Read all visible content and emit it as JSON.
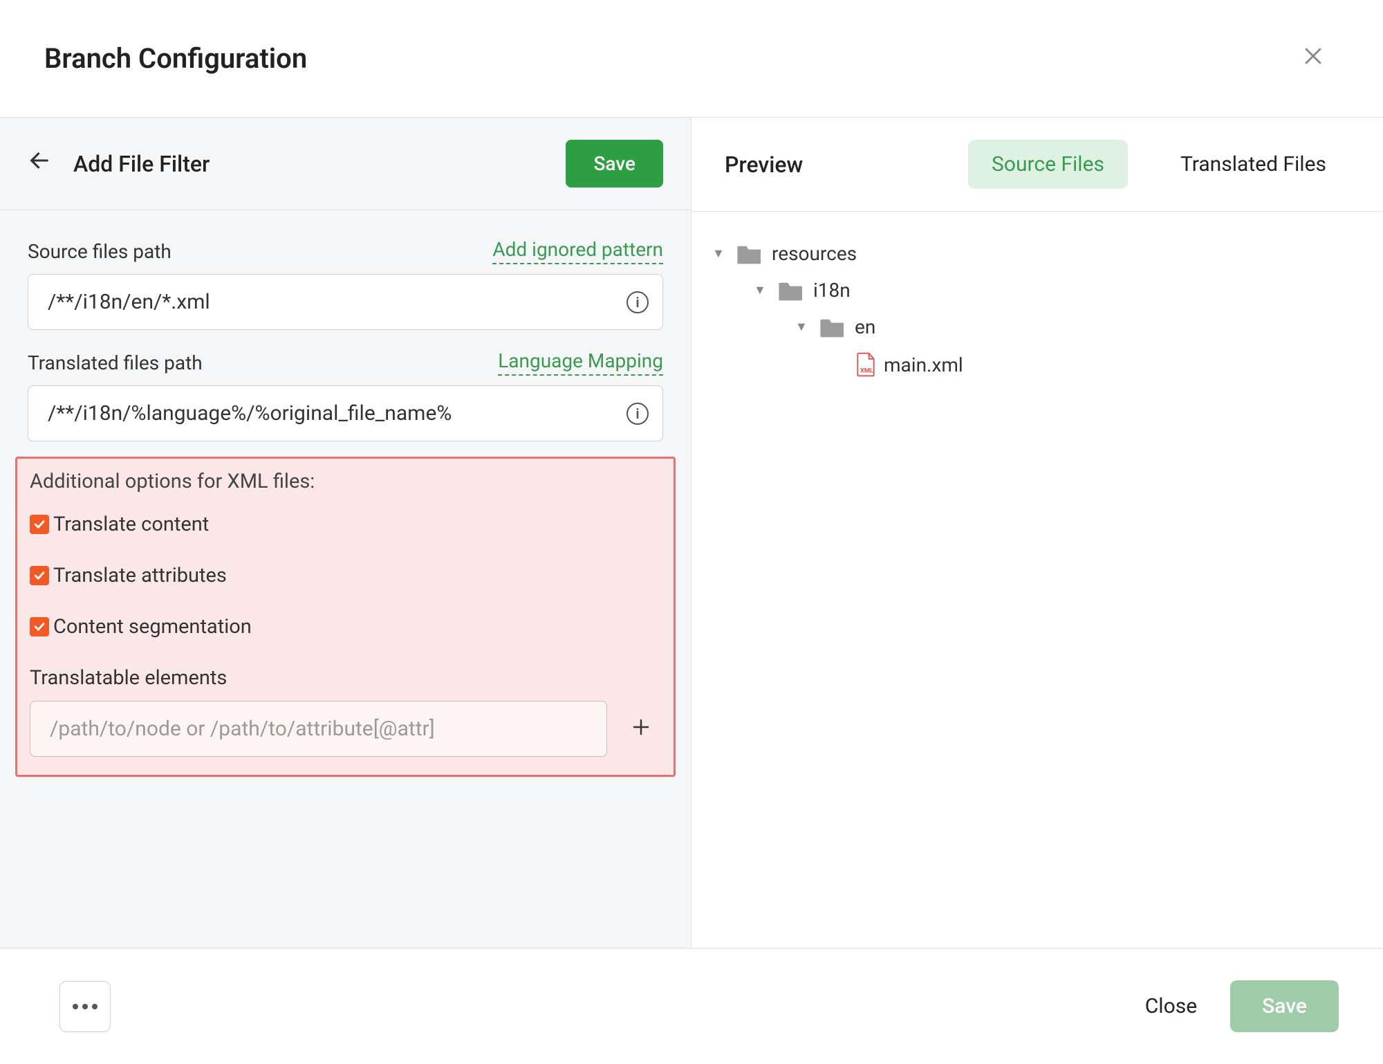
{
  "header": {
    "title": "Branch Configuration"
  },
  "leftPanel": {
    "back_aria": "Back",
    "title": "Add File Filter",
    "save_label": "Save",
    "source_path_label": "Source files path",
    "add_ignored_label": "Add ignored pattern",
    "source_path_value": "/**/i18n/en/*.xml",
    "translated_path_label": "Translated files path",
    "lang_mapping_label": "Language Mapping",
    "translated_path_value": "/**/i18n/%language%/%original_file_name%"
  },
  "xmlOptions": {
    "title": "Additional options for XML files:",
    "translate_content_label": "Translate content",
    "translate_attributes_label": "Translate attributes",
    "content_segmentation_label": "Content segmentation",
    "translatable_elements_label": "Translatable elements",
    "translatable_elements_placeholder": "/path/to/node or /path/to/attribute[@attr]"
  },
  "rightPanel": {
    "preview_label": "Preview",
    "tab_source": "Source Files",
    "tab_translated": "Translated Files",
    "tree": {
      "node0": "resources",
      "node1": "i18n",
      "node2": "en",
      "node3": "main.xml"
    }
  },
  "footer": {
    "close_label": "Close",
    "save_label": "Save"
  }
}
